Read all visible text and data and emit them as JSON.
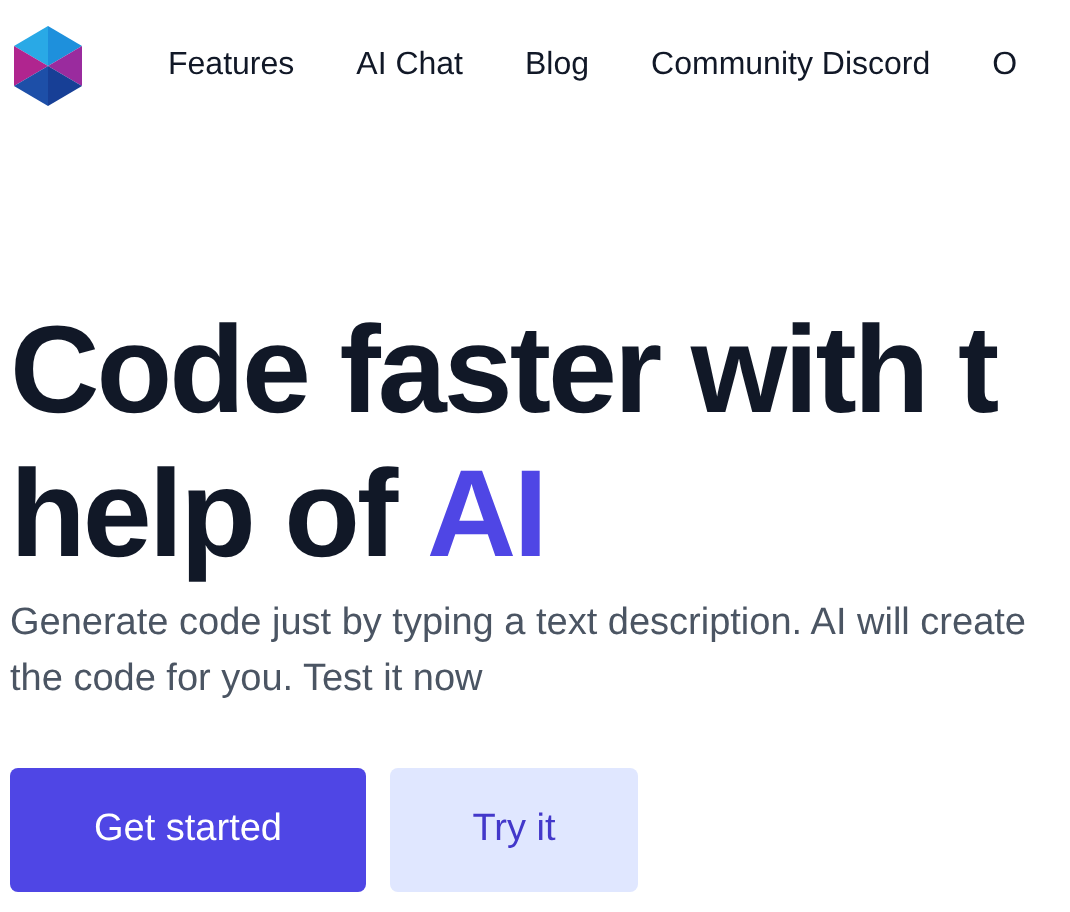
{
  "nav": {
    "links": [
      "Features",
      "AI Chat",
      "Blog",
      "Community Discord",
      "O"
    ]
  },
  "hero": {
    "title_lines": [
      "Code faster with t",
      "help of **AI**"
    ],
    "subtitle": "Generate code just by typing a text description. AI will create the code for you. Test it now",
    "buttons": [
      {
        "label": "Get started",
        "kind": "primary"
      },
      {
        "label": "Try it",
        "kind": "secondary"
      }
    ]
  }
}
